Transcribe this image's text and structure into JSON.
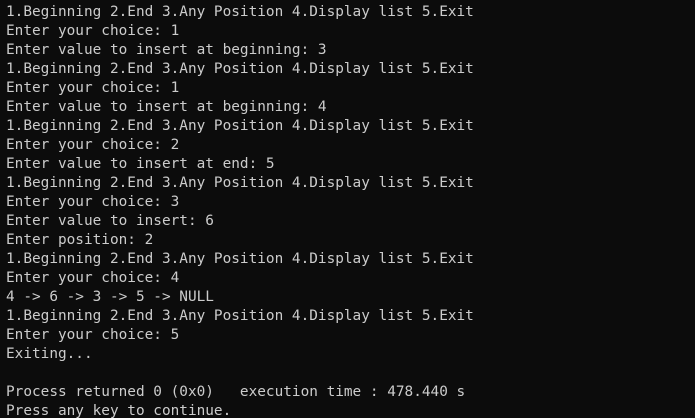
{
  "console": {
    "lines": [
      "1.Beginning 2.End 3.Any Position 4.Display list 5.Exit",
      "Enter your choice: 1",
      "Enter value to insert at beginning: 3",
      "1.Beginning 2.End 3.Any Position 4.Display list 5.Exit",
      "Enter your choice: 1",
      "Enter value to insert at beginning: 4",
      "1.Beginning 2.End 3.Any Position 4.Display list 5.Exit",
      "Enter your choice: 2",
      "Enter value to insert at end: 5",
      "1.Beginning 2.End 3.Any Position 4.Display list 5.Exit",
      "Enter your choice: 3",
      "Enter value to insert: 6",
      "Enter position: 2",
      "1.Beginning 2.End 3.Any Position 4.Display list 5.Exit",
      "Enter your choice: 4",
      "4 -> 6 -> 3 -> 5 -> NULL",
      "1.Beginning 2.End 3.Any Position 4.Display list 5.Exit",
      "Enter your choice: 5",
      "Exiting..."
    ],
    "process_status": "Process returned 0 (0x0)   execution time : 478.440 s",
    "continue_prompt": "Press any key to continue."
  },
  "colors": {
    "background": "#0c0c0c",
    "text": "#cccccc"
  }
}
